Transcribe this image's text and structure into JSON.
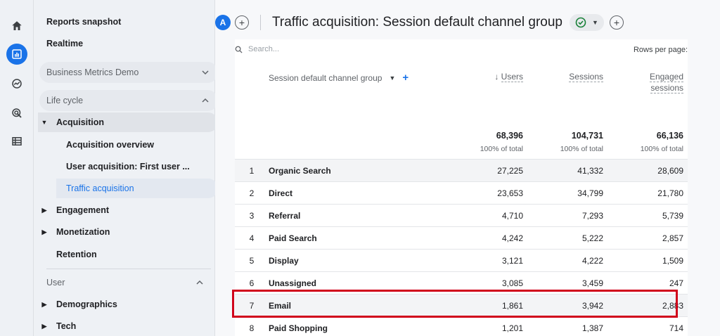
{
  "rail": {
    "icons": [
      "home-icon",
      "reports-icon",
      "explore-icon",
      "advertising-icon",
      "configure-icon"
    ]
  },
  "sidebar": {
    "reports_snapshot": "Reports snapshot",
    "realtime": "Realtime",
    "collection": "Business Metrics Demo",
    "lifecycle": "Life cycle",
    "acquisition": "Acquisition",
    "acquisition_overview": "Acquisition overview",
    "user_acquisition": "User acquisition: First user ...",
    "traffic_acquisition": "Traffic acquisition",
    "engagement": "Engagement",
    "monetization": "Monetization",
    "retention": "Retention",
    "user": "User",
    "demographics": "Demographics",
    "tech": "Tech"
  },
  "header": {
    "avatar_letter": "A",
    "title": "Traffic acquisition: Session default channel group"
  },
  "table": {
    "search_placeholder": "Search...",
    "rows_per_page": "Rows per page:",
    "dimension_header": "Session default channel group",
    "col_users": "Users",
    "col_sessions": "Sessions",
    "col_engaged_1": "Engaged",
    "col_engaged_2": "sessions",
    "totals": {
      "users": "68,396",
      "sessions": "104,731",
      "engaged": "66,136",
      "pct": "100% of total"
    },
    "rows": [
      {
        "idx": "1",
        "name": "Organic Search",
        "users": "27,225",
        "sessions": "41,332",
        "engaged": "28,609"
      },
      {
        "idx": "2",
        "name": "Direct",
        "users": "23,653",
        "sessions": "34,799",
        "engaged": "21,780"
      },
      {
        "idx": "3",
        "name": "Referral",
        "users": "4,710",
        "sessions": "7,293",
        "engaged": "5,739"
      },
      {
        "idx": "4",
        "name": "Paid Search",
        "users": "4,242",
        "sessions": "5,222",
        "engaged": "2,857"
      },
      {
        "idx": "5",
        "name": "Display",
        "users": "3,121",
        "sessions": "4,222",
        "engaged": "1,509"
      },
      {
        "idx": "6",
        "name": "Unassigned",
        "users": "3,085",
        "sessions": "3,459",
        "engaged": "247"
      },
      {
        "idx": "7",
        "name": "Email",
        "users": "1,861",
        "sessions": "3,942",
        "engaged": "2,883"
      },
      {
        "idx": "8",
        "name": "Paid Shopping",
        "users": "1,201",
        "sessions": "1,387",
        "engaged": "714"
      }
    ]
  },
  "colors": {
    "accent": "#1a73e8",
    "highlight": "#d0021b",
    "success": "#188038"
  }
}
